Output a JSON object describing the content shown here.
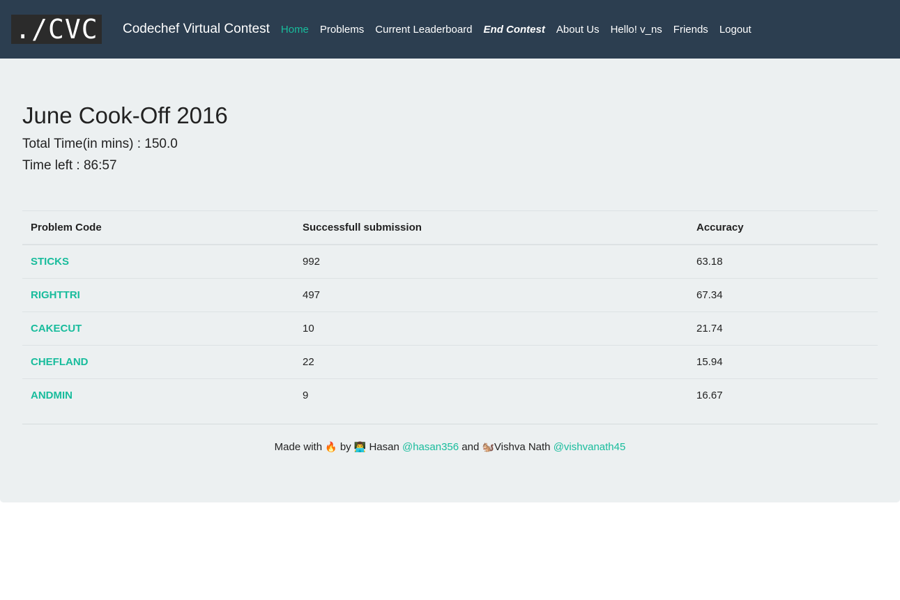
{
  "navbar": {
    "logo_text": "./CVC",
    "brand": "Codechef Virtual Contest",
    "links": {
      "home": "Home",
      "problems": "Problems",
      "leaderboard": "Current Leaderboard",
      "end_contest": "End Contest",
      "about": "About Us",
      "hello": "Hello! v_ns",
      "friends": "Friends",
      "logout": "Logout"
    },
    "active_color": "#18bc9c",
    "background": "#2c3e50"
  },
  "contest": {
    "title": "June Cook-Off 2016",
    "total_time": "Total Time(in mins) : 150.0",
    "time_left": "Time left : 86:57"
  },
  "table": {
    "headers": [
      "Problem Code",
      "Successfull submission",
      "Accuracy"
    ],
    "rows": [
      {
        "code": "STICKS",
        "submissions": "992",
        "accuracy": "63.18"
      },
      {
        "code": "RIGHTTRI",
        "submissions": "497",
        "accuracy": "67.34"
      },
      {
        "code": "CAKECUT",
        "submissions": "10",
        "accuracy": "21.74"
      },
      {
        "code": "CHEFLAND",
        "submissions": "22",
        "accuracy": "15.94"
      },
      {
        "code": "ANDMIN",
        "submissions": "9",
        "accuracy": "16.67"
      }
    ]
  },
  "footer": {
    "made_with": "Made with",
    "fire_emoji": "🔥",
    "by": "by",
    "person_emoji": "👨‍💻",
    "name1": "Hasan",
    "handle1": "@hasan356",
    "and": "and",
    "squirrel_emoji": "🐿️",
    "name2": "Vishva Nath",
    "handle2": "@vishvanath45"
  }
}
